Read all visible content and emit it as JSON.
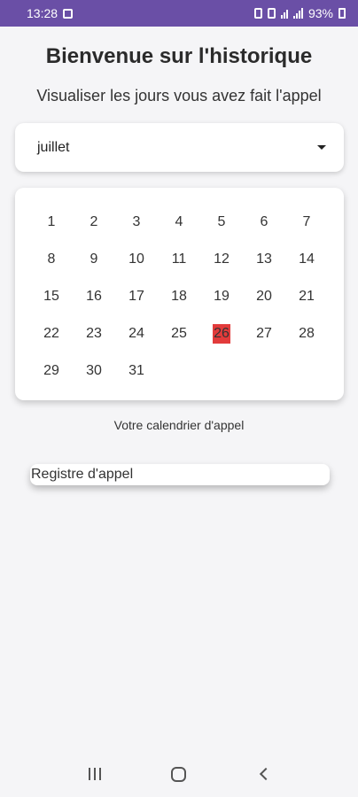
{
  "status_bar": {
    "time": "13:28",
    "battery": "93%"
  },
  "page": {
    "title": "Bienvenue sur l'historique",
    "subtitle": "Visualiser les jours vous avez fait l'appel"
  },
  "month_selector": {
    "selected": "juillet"
  },
  "calendar": {
    "days": [
      "1",
      "2",
      "3",
      "4",
      "5",
      "6",
      "7",
      "8",
      "9",
      "10",
      "11",
      "12",
      "13",
      "14",
      "15",
      "16",
      "17",
      "18",
      "19",
      "20",
      "21",
      "22",
      "23",
      "24",
      "25",
      "26",
      "27",
      "28",
      "29",
      "30",
      "31"
    ],
    "marked_day": "26",
    "marked_color": "#e23b3b",
    "caption": "Votre calendrier d'appel"
  },
  "registre": {
    "label": "Registre d'appel"
  },
  "nav_bar": {
    "icons": [
      "recent-apps-icon",
      "home-icon",
      "back-icon"
    ]
  }
}
